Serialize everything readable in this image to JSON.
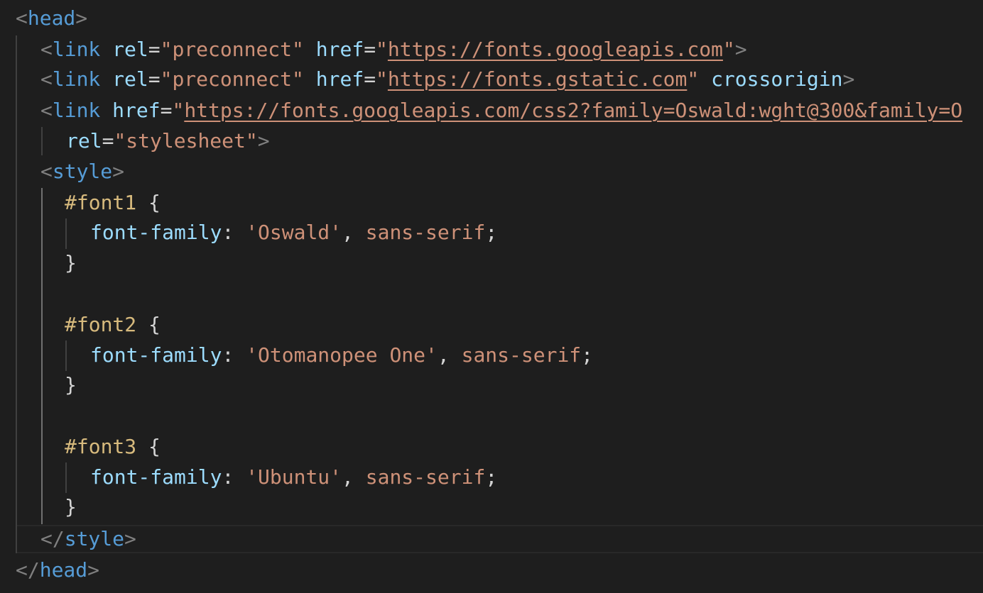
{
  "editor": {
    "theme_colors": {
      "background": "#1e1e1e",
      "tag": "#569cd6",
      "attribute": "#9cdcfe",
      "string": "#ce9178",
      "selector": "#d7ba7d",
      "bracket": "#808080"
    },
    "lines": {
      "l1": {
        "tag": "head"
      },
      "l2": {
        "tag": "link",
        "attr1": "rel",
        "val1": "\"preconnect\"",
        "attr2": "href",
        "q_open": "\"",
        "url": "https://fonts.googleapis.com",
        "q_close": "\""
      },
      "l3": {
        "tag": "link",
        "attr1": "rel",
        "val1": "\"preconnect\"",
        "attr2": "href",
        "q_open": "\"",
        "url": "https://fonts.gstatic.com",
        "q_close": "\"",
        "attr3": "crossorigin"
      },
      "l4": {
        "tag": "link",
        "attr1": "href",
        "q_open": "\"",
        "url": "https://fonts.googleapis.com/css2?family=Oswald:wght@300&family=O"
      },
      "l5": {
        "attr1": "rel",
        "val1": "\"stylesheet\""
      },
      "l6": {
        "tag": "style"
      },
      "l7": {
        "selector": "#font1",
        "brace": "{"
      },
      "l8": {
        "prop": "font-family",
        "value": "'Oswald'",
        "value2": "sans-serif"
      },
      "l9": {
        "brace": "}"
      },
      "l11": {
        "selector": "#font2",
        "brace": "{"
      },
      "l12": {
        "prop": "font-family",
        "value": "'Otomanopee One'",
        "value2": "sans-serif"
      },
      "l13": {
        "brace": "}"
      },
      "l15": {
        "selector": "#font3",
        "brace": "{"
      },
      "l16": {
        "prop": "font-family",
        "value": "'Ubuntu'",
        "value2": "sans-serif"
      },
      "l17": {
        "brace": "}"
      },
      "l18": {
        "tag": "style"
      },
      "l19": {
        "tag": "head"
      }
    }
  }
}
